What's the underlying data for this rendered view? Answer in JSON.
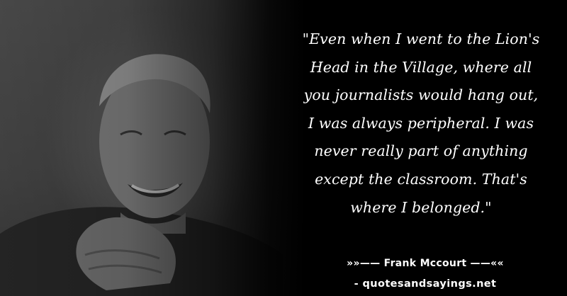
{
  "quote": {
    "lines": [
      "\"Even when I went to the Lion's",
      "Head in the Village, where all",
      "you journalists would hang out,",
      "I was always peripheral. I was",
      "never really part of anything",
      "except the classroom. That's",
      "where I belonged.\""
    ]
  },
  "attribution": {
    "author_line": "»»—— Frank Mccourt ——««"
  },
  "source": {
    "text": "- quotesandsayings.net"
  },
  "colors": {
    "background": "#000000",
    "text": "#ffffff"
  }
}
